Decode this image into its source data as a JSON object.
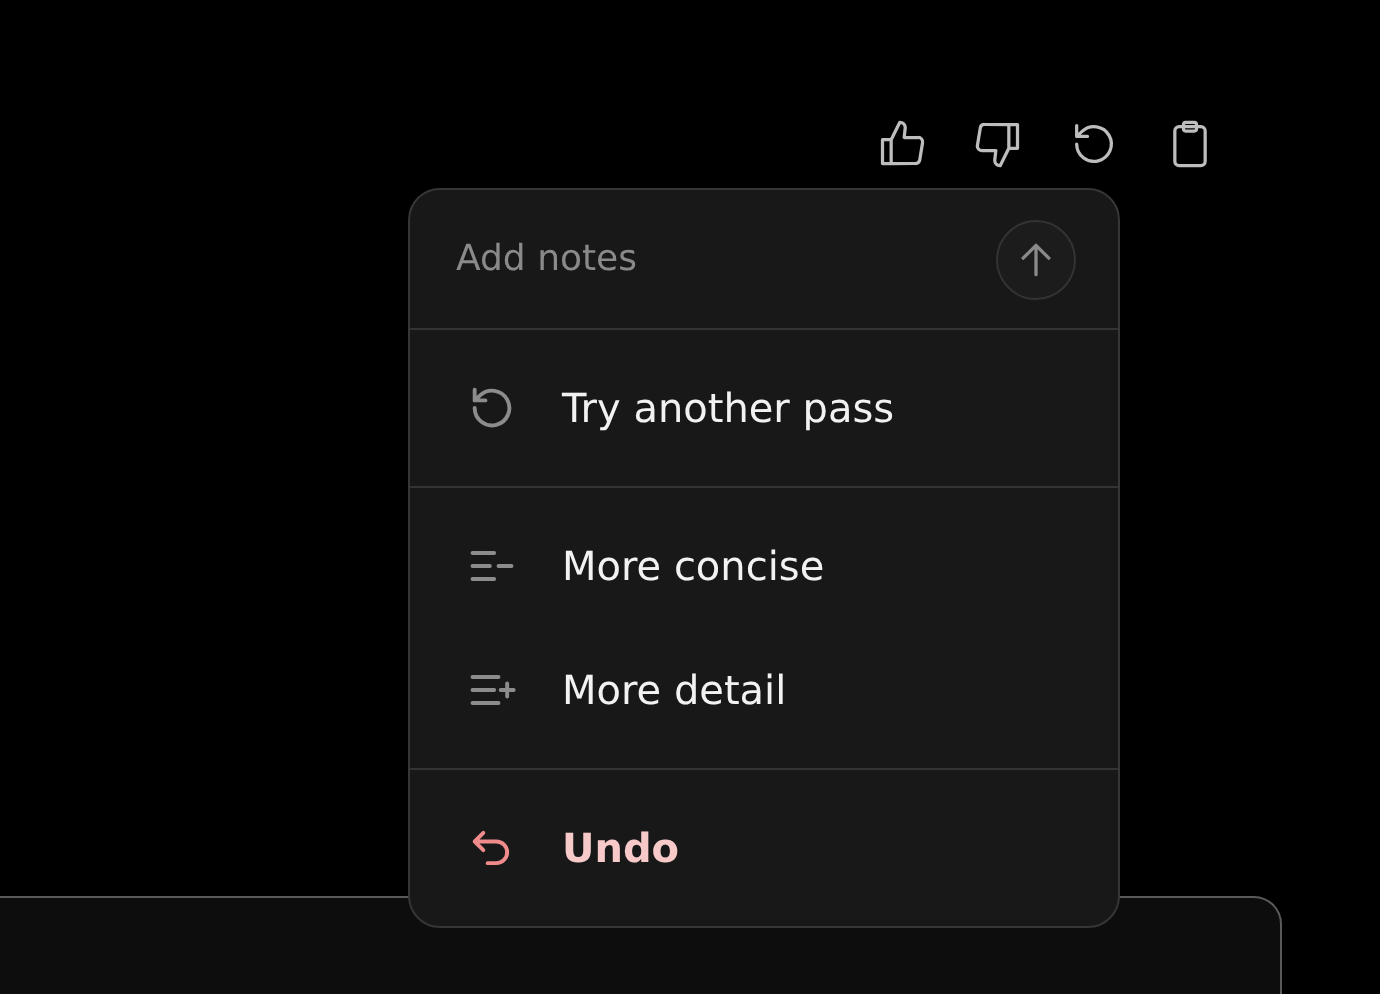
{
  "notes": {
    "placeholder": "Add notes"
  },
  "menu_sections": [
    [
      {
        "kind": "retry",
        "label": "Try another pass"
      }
    ],
    [
      {
        "kind": "concise",
        "label": "More concise"
      },
      {
        "kind": "detail",
        "label": "More detail"
      }
    ],
    [
      {
        "kind": "undo",
        "label": "Undo"
      }
    ]
  ]
}
